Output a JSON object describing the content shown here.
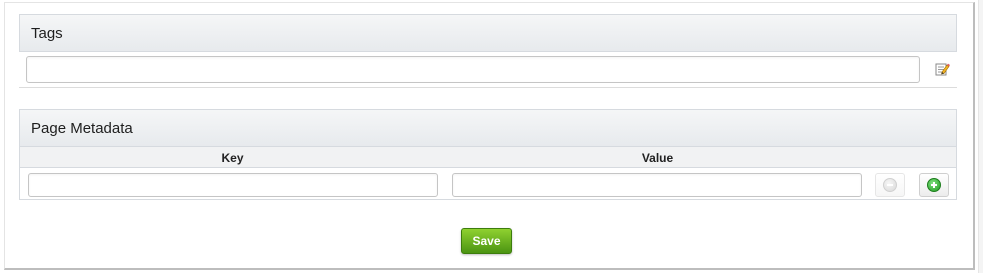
{
  "tags": {
    "title": "Tags",
    "input_value": "",
    "edit_icon": "edit-note-icon"
  },
  "metadata": {
    "title": "Page Metadata",
    "columns": [
      "Key",
      "Value"
    ],
    "rows": [
      {
        "key": "",
        "value": ""
      }
    ],
    "remove_icon": "minus-circle-icon",
    "add_icon": "plus-circle-icon"
  },
  "actions": {
    "save_label": "Save"
  },
  "colors": {
    "save_button": "#5ea51a",
    "add_icon": "#2aa52a",
    "section_header": "#eceff2"
  }
}
